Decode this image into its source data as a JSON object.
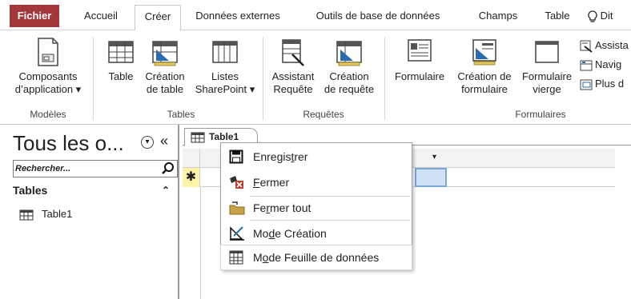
{
  "ribbon_tabs": [
    {
      "label": "Fichier"
    },
    {
      "label": "Accueil"
    },
    {
      "label": "Créer"
    },
    {
      "label": "Données externes"
    },
    {
      "label": "Outils de base de données"
    },
    {
      "label": "Champs"
    },
    {
      "label": "Table"
    },
    {
      "label": "Dit"
    }
  ],
  "ribbon": {
    "app_parts_line1": "Composants",
    "app_parts_line2": "d’application ▾",
    "group_models": "Modèles",
    "table": "Table",
    "table_design_line1": "Création",
    "table_design_line2": "de table",
    "sharepoint_line1": "Listes",
    "sharepoint_line2": "SharePoint ▾",
    "group_tables": "Tables",
    "query_wizard_line1": "Assistant",
    "query_wizard_line2": "Requête",
    "query_design_line1": "Création",
    "query_design_line2": "de requête",
    "group_queries": "Requêtes",
    "form": "Formulaire",
    "form_design_line1": "Création de",
    "form_design_line2": "formulaire",
    "blank_form_line1": "Formulaire",
    "blank_form_line2": "vierge",
    "group_forms": "Formulaires",
    "form_wizard": "Assista",
    "navigation": "Navig",
    "more_forms": "Plus d"
  },
  "nav": {
    "title": "Tous les o...",
    "collapse": "«",
    "search_placeholder": "Rechercher...",
    "section": "Tables",
    "section_chevron": "⌃",
    "items": [
      {
        "label": "Table1"
      }
    ]
  },
  "doc": {
    "tab_label": "Table1",
    "new_row_marker": "✱",
    "col_arrow": "▾"
  },
  "context_menu": {
    "items": [
      {
        "pre": "Enregis",
        "key": "t",
        "post": "rer"
      },
      {
        "pre": "",
        "key": "F",
        "post": "ermer"
      },
      {
        "pre": "Fe",
        "key": "r",
        "post": "mer tout"
      },
      {
        "pre": "Mo",
        "key": "d",
        "post": "e Création"
      },
      {
        "pre": "M",
        "key": "o",
        "post": "de Feuille de données"
      }
    ]
  },
  "colors": {
    "file_tab": "#a4373a",
    "new_row_marker": "#fff3a8",
    "selected_cell": "#cfe2f5"
  }
}
